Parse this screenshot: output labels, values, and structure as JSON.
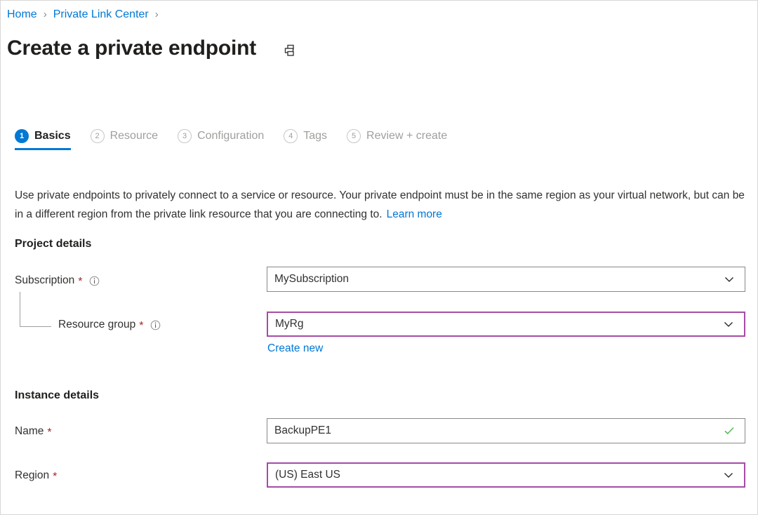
{
  "breadcrumb": {
    "items": [
      {
        "label": "Home"
      },
      {
        "label": "Private Link Center"
      }
    ],
    "separator": "›"
  },
  "header": {
    "title": "Create a private endpoint",
    "print_icon": "printer-icon"
  },
  "tabs": [
    {
      "num": "1",
      "label": "Basics",
      "state": "active"
    },
    {
      "num": "2",
      "label": "Resource",
      "state": "inactive"
    },
    {
      "num": "3",
      "label": "Configuration",
      "state": "inactive"
    },
    {
      "num": "4",
      "label": "Tags",
      "state": "inactive"
    },
    {
      "num": "5",
      "label": "Review + create",
      "state": "inactive"
    }
  ],
  "description": {
    "text": "Use private endpoints to privately connect to a service or resource. Your private endpoint must be in the same region as your virtual network, but can be in a different region from the private link resource that you are connecting to.",
    "link_label": "Learn more"
  },
  "sections": {
    "project_details": {
      "heading": "Project details",
      "subscription": {
        "label": "Subscription",
        "required_marker": "*",
        "info_icon": "info-icon",
        "value": "MySubscription",
        "chevron_icon": "chevron-down-icon"
      },
      "resource_group": {
        "label": "Resource group",
        "required_marker": "*",
        "info_icon": "info-icon",
        "value": "MyRg",
        "chevron_icon": "chevron-down-icon",
        "create_new_label": "Create new"
      }
    },
    "instance_details": {
      "heading": "Instance details",
      "name": {
        "label": "Name",
        "required_marker": "*",
        "value": "BackupPE1",
        "validation_icon": "checkmark-icon"
      },
      "region": {
        "label": "Region",
        "required_marker": "*",
        "value": "(US) East US",
        "chevron_icon": "chevron-down-icon"
      }
    }
  },
  "colors": {
    "link_blue": "#0078d4",
    "accent_blue": "#0078d4",
    "focus_purple": "#a64ca6",
    "required_red": "#a4262c",
    "valid_green": "#5cb85c",
    "border_gray": "#8a8886",
    "muted_gray": "#a19f9d"
  }
}
